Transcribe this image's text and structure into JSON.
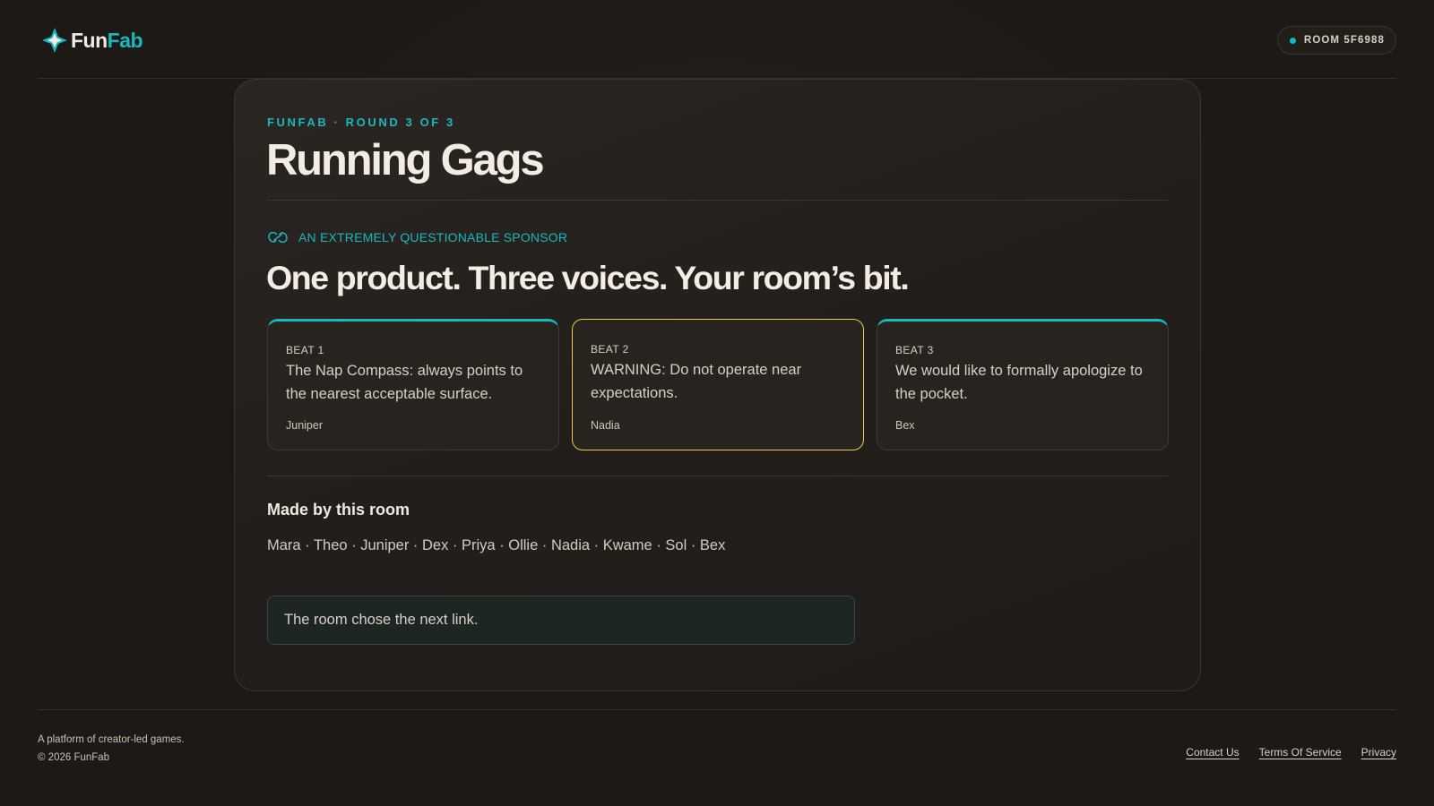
{
  "header": {
    "logo": {
      "part1": "Fun",
      "part2": "Fab",
      "icon": "star-diamond-icon"
    },
    "room_badge": "ROOM 5F6988",
    "colors": {
      "accent": "#18b8bf",
      "highlight": "#f2c843"
    }
  },
  "main": {
    "kicker": "FUNFAB · ROUND 3 OF 3",
    "title": "Running Gags",
    "sponsor_label": "AN EXTREMELY QUESTIONABLE SPONSOR",
    "headline": "One product. Three voices. Your room’s bit.",
    "beats": [
      {
        "label": "BEAT 1",
        "text": "The Nap Compass: always points to the nearest acceptable surface.",
        "author": "Juniper",
        "selected": false
      },
      {
        "label": "BEAT 2",
        "text": "WARNING: Do not operate near expectations.",
        "author": "Nadia",
        "selected": true
      },
      {
        "label": "BEAT 3",
        "text": "We would like to formally apologize to the pocket.",
        "author": "Bex",
        "selected": false
      }
    ],
    "made_by_title": "Made by this room",
    "members": "Mara · Theo · Juniper · Dex · Priya · Ollie · Nadia · Kwame · Sol · Bex",
    "status": "The room chose the next link."
  },
  "footer": {
    "tagline": "A platform of creator-led games.",
    "copyright": "© 2026 FunFab",
    "links": [
      "Contact Us",
      "Terms Of Service",
      "Privacy"
    ]
  }
}
